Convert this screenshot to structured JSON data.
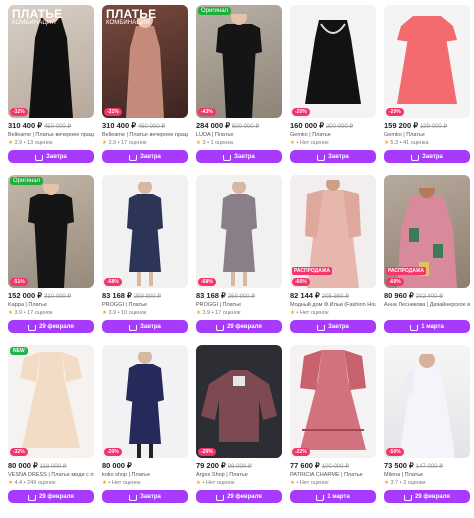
{
  "colors": {
    "accent": "#a73afd",
    "discount": "#f2356a",
    "original": "#1fae3b",
    "star": "#f5a623"
  },
  "cards": [
    {
      "promo_title": "ПЛАТЬЕ",
      "promo_sub": "КОМБИНАЦИЯ",
      "discount": "-32%",
      "price": "310 400 ₽",
      "old_price": "450 000 ₽",
      "title": "Belleame | Платье вечернее праздничн...",
      "rating": "3.9",
      "reviews": "• 13 оценок",
      "button": "Завтра"
    },
    {
      "promo_title": "ПЛАТЬЕ",
      "promo_sub": "КОМБИНАЦИЯ",
      "discount": "-31%",
      "price": "310 400 ₽",
      "old_price": "450 000 ₽",
      "title": "Belleame | Платье вечернее праздничн...",
      "rating": "3.9",
      "reviews": "• 17 оценок",
      "button": "Завтра"
    },
    {
      "badge": "Оригинал",
      "discount": "-43%",
      "price": "284 000 ₽",
      "old_price": "500 000 ₽",
      "title": "LUDA | Платье",
      "rating": "3",
      "reviews": "• 1 оценка",
      "button": "Завтра"
    },
    {
      "discount": "-20%",
      "price": "160 000 ₽",
      "old_price": "200 000 ₽",
      "title": "Gemko | Платье",
      "rating": "",
      "reviews": "• Нет оценок",
      "button": "Завтра"
    },
    {
      "discount": "-20%",
      "price": "159 200 ₽",
      "old_price": "199 000 ₽",
      "title": "Gemko | Платье",
      "rating": "5.3",
      "reviews": "• 41 оценка",
      "button": "Завтра"
    },
    {
      "badge": "Оригинал",
      "discount": "-51%",
      "price": "152 000 ₽",
      "old_price": "310 000 ₽",
      "title": "Kappa | Платье",
      "rating": "3.9",
      "reviews": "• 17 оценок",
      "button": "29 февраля"
    },
    {
      "discount": "-68%",
      "price": "83 168 ₽",
      "old_price": "259 900 ₽",
      "title": "PROGGI | Платье",
      "rating": "3.9",
      "reviews": "• 10 оценок",
      "button": "Завтра"
    },
    {
      "discount": "-68%",
      "price": "83 168 ₽",
      "old_price": "259 900 ₽",
      "title": "PROGGI | Платье",
      "rating": "3.9",
      "reviews": "• 17 оценок",
      "button": "29 февраля"
    },
    {
      "badge_bottom": "РАСПРОДАЖА",
      "discount": "-60%",
      "price": "82 144 ₽",
      "old_price": "205 360 ₽",
      "title": "Модный дом Ф.Ильи (Fashion House ty...",
      "rating": "",
      "reviews": "• Нет оценок",
      "button": "Завтра"
    },
    {
      "badge_bottom": "РАСПРОДАЖА",
      "discount": "-60%",
      "price": "80 960 ₽",
      "old_price": "202 400 ₽",
      "title": "Анна Лесникова | Дизайнерское вечерн...",
      "rating": "",
      "reviews": "",
      "button": "1 марта"
    },
    {
      "badge": "NEW",
      "discount": "-32%",
      "price": "80 000 ₽",
      "old_price": "118 000 ₽",
      "title": "VESNA DRESS | Платье миди с открыт...",
      "rating": "4.4",
      "reviews": "• 249 оценок",
      "button": "29 февраля"
    },
    {
      "discount": "-20%",
      "price": "80 000 ₽",
      "old_price": "",
      "title": "koko shop | Платье",
      "rating": "",
      "reviews": "• Нет оценок",
      "button": "Завтра"
    },
    {
      "discount": "-20%",
      "price": "79 200 ₽",
      "old_price": "99 000 ₽",
      "title": "Argos Shop | Платье",
      "rating": "",
      "reviews": "• Нет оценок",
      "button": "29 февраля"
    },
    {
      "discount": "-22%",
      "price": "77 600 ₽",
      "old_price": "100 000 ₽",
      "title": "PATRICIA CHARME | Платье",
      "rating": "",
      "reviews": "• Нет оценок",
      "button": "1 марта"
    },
    {
      "discount": "-50%",
      "price": "73 500 ₽",
      "old_price": "147 000 ₽",
      "title": "Milena | Платье",
      "rating": "3.7",
      "reviews": "• 3 оценки",
      "button": "29 февраля"
    }
  ]
}
